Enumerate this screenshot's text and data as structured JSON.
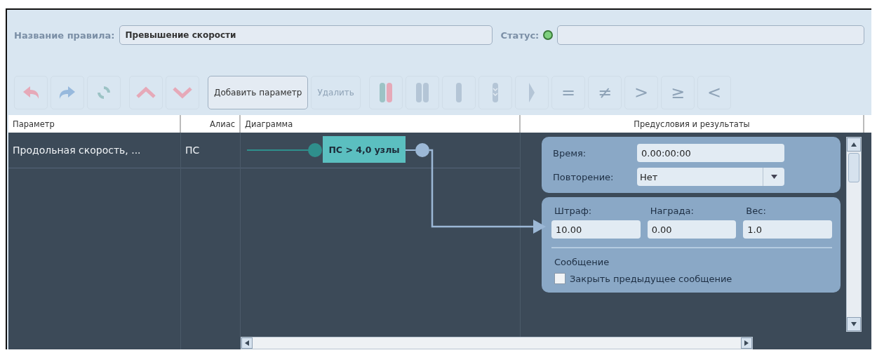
{
  "rule_name": {
    "label": "Название правила:",
    "value": "Превышение скорости"
  },
  "status": {
    "label": "Статус:",
    "color": "#7ed07e"
  },
  "toolbar": [
    {
      "kind": "icon",
      "disabled": true
    },
    {
      "kind": "icon",
      "disabled": true
    },
    {
      "kind": "icon",
      "disabled": true
    },
    {
      "kind": "icon",
      "disabled": true
    },
    {
      "kind": "icon",
      "disabled": true
    },
    {
      "kind": "text",
      "label": "Добавить параметр",
      "disabled": false
    },
    {
      "kind": "text",
      "label": "Удалить",
      "disabled": true
    },
    {
      "kind": "icon",
      "disabled": true
    },
    {
      "kind": "icon",
      "disabled": true
    },
    {
      "kind": "icon",
      "disabled": true
    },
    {
      "kind": "icon",
      "disabled": true
    },
    {
      "kind": "icon",
      "disabled": true
    },
    {
      "kind": "symbol",
      "label": "=",
      "disabled": true
    },
    {
      "kind": "symbol",
      "label": "≠",
      "disabled": true
    },
    {
      "kind": "symbol",
      "label": ">",
      "disabled": true
    },
    {
      "kind": "symbol",
      "label": "≥",
      "disabled": true
    },
    {
      "kind": "symbol",
      "label": "<",
      "disabled": true
    }
  ],
  "table": {
    "columns": [
      "Параметр",
      "Алиас",
      "Диаграмма",
      "Предусловия и результаты"
    ],
    "rows": [
      {
        "parameter": "Продольная скорость, ...",
        "alias": "ПС",
        "condition": "ПС > 4,0 узлы"
      }
    ]
  },
  "preconditions": {
    "time": {
      "label": "Время:",
      "value": "0.00:00:00"
    },
    "repeat": {
      "label": "Повторение:",
      "value": "Нет"
    }
  },
  "results": {
    "penalty": {
      "label": "Штраф:",
      "value": "10.00"
    },
    "reward": {
      "label": "Награда:",
      "value": "0.00"
    },
    "weight": {
      "label": "Вес:",
      "value": "1.0"
    },
    "message_heading": "Сообщение",
    "close_previous": {
      "label": "Закрыть предыдущее сообщение",
      "checked": false
    }
  }
}
